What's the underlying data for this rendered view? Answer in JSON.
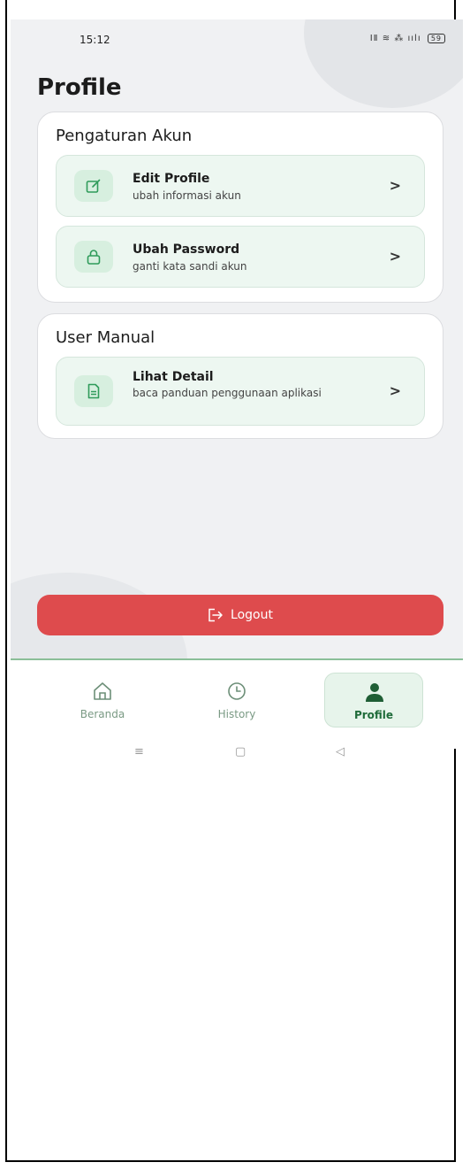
{
  "status_bar": {
    "time": "15:12",
    "icons": "ⅠⅡ ≋ ⁂ ıılı",
    "battery": "59"
  },
  "page_title": "Profile",
  "sections": [
    {
      "title": "Pengaturan Akun",
      "items": [
        {
          "title": "Edit Profile",
          "subtitle": "ubah informasi akun",
          "icon": "edit-icon",
          "chevron": ">"
        },
        {
          "title": "Ubah Password",
          "subtitle": "ganti kata sandi akun",
          "icon": "lock-icon",
          "chevron": ">"
        }
      ]
    },
    {
      "title": "User Manual",
      "items": [
        {
          "title": "Lihat Detail",
          "subtitle": "baca panduan penggunaan aplikasi",
          "icon": "document-icon",
          "chevron": ">"
        }
      ]
    }
  ],
  "logout": {
    "label": "Logout",
    "icon": "logout-icon",
    "color": "#de4b4d"
  },
  "bottom_nav": [
    {
      "label": "Beranda",
      "icon": "home-icon",
      "active": false
    },
    {
      "label": "History",
      "icon": "clock-icon",
      "active": false
    },
    {
      "label": "Profile",
      "icon": "person-icon",
      "active": true
    }
  ],
  "system_nav": {
    "menu": "≡",
    "home": "▢",
    "back": "◁"
  },
  "colors": {
    "accent": "#1f6b3a",
    "item_bg": "#edf7f1",
    "icon_bg": "#d7efdf",
    "icon_stroke": "#2f9b5a",
    "danger": "#de4b4d",
    "background": "#f0f1f3"
  }
}
